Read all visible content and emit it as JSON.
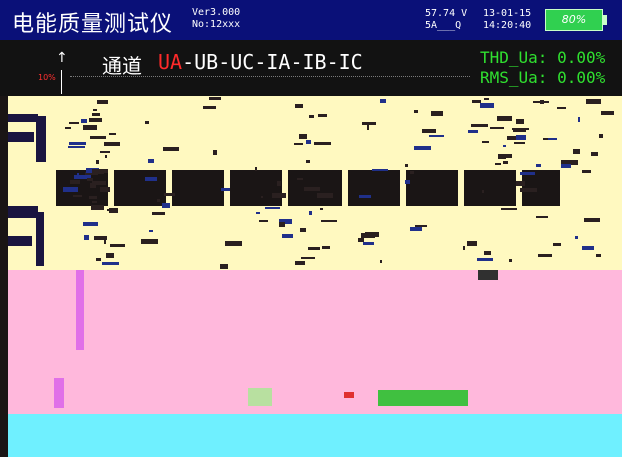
{
  "header": {
    "title": "电能质量测试仪",
    "version": "Ver3.000",
    "device_no": "No:12xxx",
    "measure_top": "57.74 V",
    "measure_bottom": "5A___Q",
    "date": "13-01-15",
    "time": "14:20:40",
    "battery": "80%"
  },
  "info": {
    "scale_label": "10%",
    "channel_label": "通道",
    "channels_active": "UA",
    "channels_rest": "-UB-UC-IA-IB-IC",
    "thd": "THD_Ua: 0.00%",
    "rms": "RMS_Ua: 0.00%"
  },
  "colors": {
    "header_bg": "#0a1078",
    "info_bg": "#121212",
    "active_channel": "#ff2a2a",
    "readout_green": "#30e030",
    "panel_yellow": "#fff9c0",
    "panel_pink": "#ffb8dc",
    "panel_cyan": "#6ff0ff",
    "battery_green": "#30d050"
  },
  "icons": {
    "battery": "battery-icon",
    "trend_arrow": "arrow-up-icon"
  }
}
